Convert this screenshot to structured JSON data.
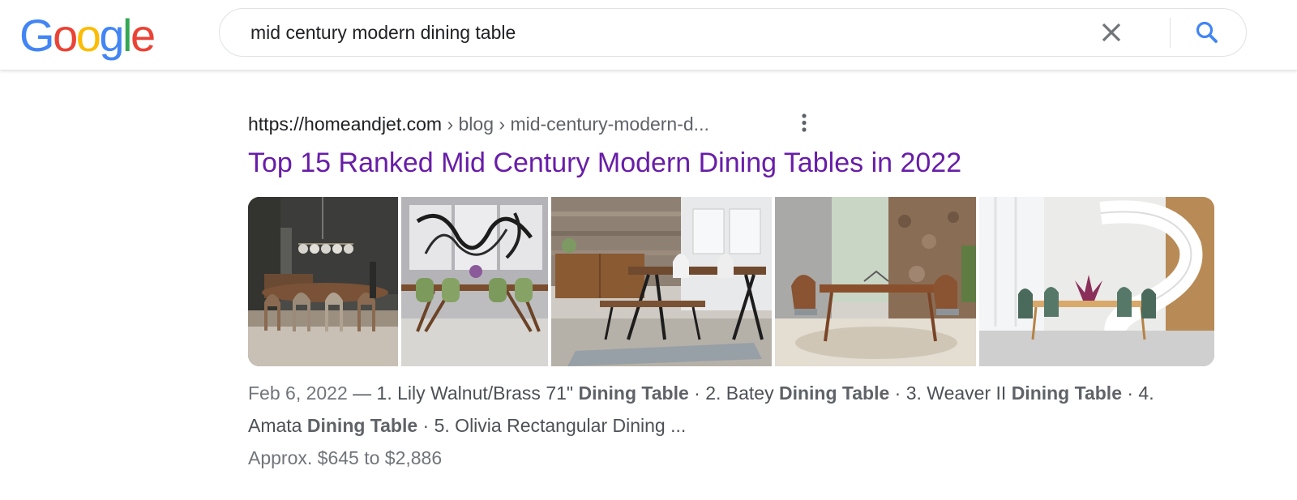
{
  "logo": {
    "letters": [
      "G",
      "o",
      "o",
      "g",
      "l",
      "e"
    ],
    "colors": [
      "#4285F4",
      "#EA4335",
      "#FBBC05",
      "#4285F4",
      "#34A853",
      "#EA4335"
    ]
  },
  "search": {
    "query": "mid century modern dining table",
    "clear_icon": "close-icon",
    "submit_icon": "search-icon",
    "accent": "#4285F4"
  },
  "result": {
    "url_domain": "https://homeandjet.com",
    "url_path": " › blog › mid-century-modern-d...",
    "more_icon": "more-vert-icon",
    "title": "Top 15 Ranked Mid Century Modern Dining Tables in 2022",
    "title_color": "#681da8",
    "images": [
      {
        "name": "dark-dining-room-photo"
      },
      {
        "name": "green-chairs-dining-photo"
      },
      {
        "name": "walnut-bench-table-photo"
      },
      {
        "name": "stone-wall-dining-photo"
      },
      {
        "name": "spiral-stair-dining-photo"
      }
    ],
    "snippet": {
      "date": "Feb 6, 2022",
      "dash": " — ",
      "p1": "1. Lily Walnut/Brass 71\" ",
      "b1": "Dining Table",
      "p2": " · 2. Batey ",
      "b2": "Dining Table",
      "p3": " · 3. Weaver II ",
      "b3": "Dining Table",
      "p4": " · 4. Amata ",
      "b4": "Dining Table",
      "p5": " · 5. Olivia Rectangular Dining ..."
    },
    "price_range": "Approx. $645 to $2,886"
  }
}
